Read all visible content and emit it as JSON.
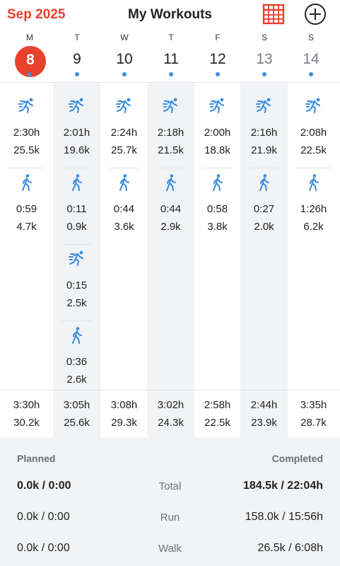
{
  "header": {
    "month": "Sep 2025",
    "title": "My Workouts",
    "calendar_icon": "calendar-grid-icon",
    "add_icon": "plus-circle-icon"
  },
  "colors": {
    "accent": "#e8412c",
    "activity_blue": "#3b8ee0",
    "shade": "#f1f3f5"
  },
  "days": [
    {
      "dow": "M",
      "num": "8",
      "today": true
    },
    {
      "dow": "T",
      "num": "9"
    },
    {
      "dow": "W",
      "num": "10"
    },
    {
      "dow": "T",
      "num": "11"
    },
    {
      "dow": "F",
      "num": "12"
    },
    {
      "dow": "S",
      "num": "13",
      "weekend": true
    },
    {
      "dow": "S",
      "num": "14",
      "weekend": true
    }
  ],
  "workouts": [
    [
      {
        "type": "run",
        "time": "2:30h",
        "dist": "25.5k"
      },
      {
        "type": "walk",
        "time": "0:59",
        "dist": "4.7k"
      }
    ],
    [
      {
        "type": "run",
        "time": "2:01h",
        "dist": "19.6k"
      },
      {
        "type": "walk",
        "time": "0:11",
        "dist": "0.9k"
      },
      {
        "type": "run",
        "time": "0:15",
        "dist": "2.5k"
      },
      {
        "type": "walk",
        "time": "0:36",
        "dist": "2.6k"
      }
    ],
    [
      {
        "type": "run",
        "time": "2:24h",
        "dist": "25.7k"
      },
      {
        "type": "walk",
        "time": "0:44",
        "dist": "3.6k"
      }
    ],
    [
      {
        "type": "run",
        "time": "2:18h",
        "dist": "21.5k"
      },
      {
        "type": "walk",
        "time": "0:44",
        "dist": "2.9k"
      }
    ],
    [
      {
        "type": "run",
        "time": "2:00h",
        "dist": "18.8k"
      },
      {
        "type": "walk",
        "time": "0:58",
        "dist": "3.8k"
      }
    ],
    [
      {
        "type": "run",
        "time": "2:16h",
        "dist": "21.9k"
      },
      {
        "type": "walk",
        "time": "0:27",
        "dist": "2.0k"
      }
    ],
    [
      {
        "type": "run",
        "time": "2:08h",
        "dist": "22.5k"
      },
      {
        "type": "walk",
        "time": "1:26h",
        "dist": "6.2k"
      }
    ]
  ],
  "day_totals": [
    {
      "time": "3:30h",
      "dist": "30.2k"
    },
    {
      "time": "3:05h",
      "dist": "25.6k"
    },
    {
      "time": "3:08h",
      "dist": "29.3k"
    },
    {
      "time": "3:02h",
      "dist": "24.3k"
    },
    {
      "time": "2:58h",
      "dist": "22.5k"
    },
    {
      "time": "2:44h",
      "dist": "23.9k"
    },
    {
      "time": "3:35h",
      "dist": "28.7k"
    }
  ],
  "summary": {
    "planned_header": "Planned",
    "completed_header": "Completed",
    "rows": [
      {
        "label": "Total",
        "planned": "0.0k / 0:00",
        "completed": "184.5k / 22:04h"
      },
      {
        "label": "Run",
        "planned": "0.0k / 0:00",
        "completed": "158.0k / 15:56h"
      },
      {
        "label": "Walk",
        "planned": "0.0k / 0:00",
        "completed": "26.5k / 6:08h"
      }
    ]
  }
}
